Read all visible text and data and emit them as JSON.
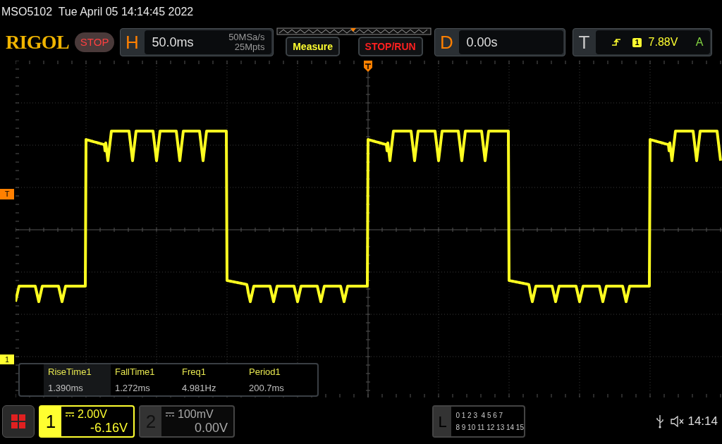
{
  "status_line": "MSO5102  Tue April 05 14:14:45 2022",
  "brand": "RIGOL",
  "run_state": {
    "label": "STOP",
    "running": false
  },
  "horizontal": {
    "label": "H",
    "scale": "50.0ms",
    "sample_rate": "50MSa/s",
    "memory_depth": "25Mpts"
  },
  "buttons": [
    {
      "label": "Measure",
      "kind": "menu"
    },
    {
      "label": "STOP/RUN",
      "kind": "run"
    }
  ],
  "delay": {
    "label": "D",
    "value": "0.00s"
  },
  "trigger": {
    "label": "T",
    "source": "1",
    "level": "7.88V",
    "mode": "A"
  },
  "markers": {
    "trigger_level": "T",
    "channel_1": "1"
  },
  "measurements": [
    {
      "name": "RiseTime1",
      "value": "1.390ms",
      "selected": true
    },
    {
      "name": "FallTime1",
      "value": "1.272ms",
      "selected": false
    },
    {
      "name": "Freq1",
      "value": "4.981Hz",
      "selected": false
    },
    {
      "name": "Period1",
      "value": "200.7ms",
      "selected": false
    }
  ],
  "channels": [
    {
      "label": "1",
      "scale": "2.00V",
      "offset": "-6.16V",
      "on": true
    },
    {
      "label": "2",
      "scale": "100mV",
      "offset": "0.00V",
      "on": false
    }
  ],
  "logic": {
    "label": "L",
    "rows": [
      "0 1 2 3  4 5 6 7",
      "8 9 10 11 12 13 14 15"
    ]
  },
  "clock": "14:14"
}
